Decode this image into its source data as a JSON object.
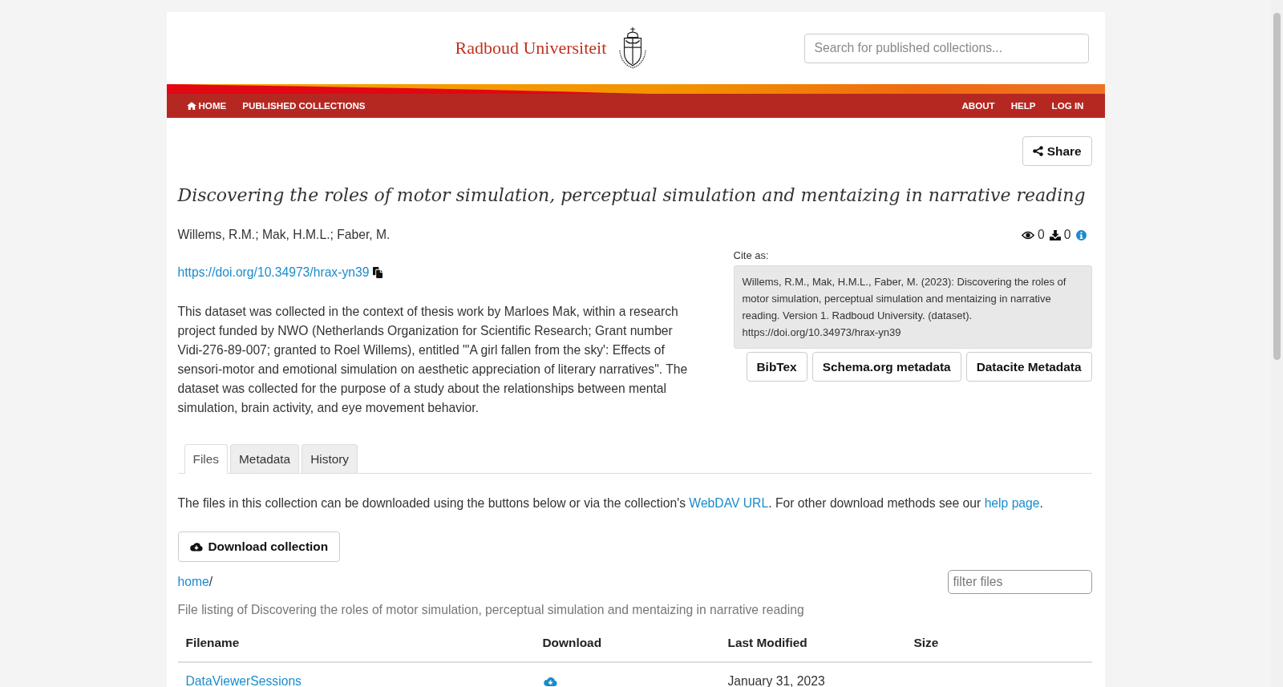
{
  "header": {
    "logo_text": "Radboud Universiteit",
    "search": {
      "placeholder": "Search for published collections..."
    }
  },
  "nav": {
    "left": [
      {
        "label": "HOME",
        "kind": "home"
      },
      {
        "label": "PUBLISHED COLLECTIONS",
        "kind": "link"
      }
    ],
    "right": [
      {
        "label": "ABOUT"
      },
      {
        "label": "HELP"
      },
      {
        "label": "LOG IN"
      }
    ]
  },
  "share_button": "Share",
  "title": "Discovering the roles of motor simulation, perceptual simulation and mentaizing in narrative reading",
  "authors": "Willems, R.M.; Mak, H.M.L.; Faber, M.",
  "doi": "https://doi.org/10.34973/hrax-yn39",
  "description": "This dataset was collected in the context of thesis work by Marloes Mak, within a research project funded by NWO (Netherlands Organization for Scientific Research; Grant number Vidi-276-89-007; granted to Roel Willems), entitled \"'A girl fallen from the sky': Effects of sensori-motor and emotional simulation on aesthetic appreciation of literary narratives\". The dataset was collected for the purpose of a study about the relationships between mental simulation, brain activity, and eye movement behavior.",
  "stats": {
    "views": "0",
    "downloads": "0"
  },
  "citation": {
    "label": "Cite as:",
    "text": "Willems, R.M., Mak, H.M.L., Faber, M. (2023): Discovering the roles of motor simulation, perceptual simulation and mentaizing in narrative reading. Version 1. Radboud University. (dataset). https://doi.org/10.34973/hrax-yn39",
    "buttons": [
      "BibTex",
      "Schema.org metadata",
      "Datacite Metadata"
    ]
  },
  "tabs": [
    {
      "label": "Files",
      "selected": true
    },
    {
      "label": "Metadata",
      "selected": false
    },
    {
      "label": "History",
      "selected": false
    }
  ],
  "files": {
    "intro": [
      {
        "kind": "text",
        "text": "The files in this collection can be downloaded using the buttons below or via the collection's "
      },
      {
        "kind": "link",
        "text": "WebDAV URL"
      },
      {
        "kind": "text",
        "text": ". For other download methods see our "
      },
      {
        "kind": "link",
        "text": "help page"
      },
      {
        "kind": "text",
        "text": "."
      }
    ],
    "download_button": "Download collection",
    "breadcrumb": {
      "link": "home",
      "separator": "/"
    },
    "filter": {
      "placeholder": "filter files"
    },
    "caption": "File listing of Discovering the roles of motor simulation, perceptual simulation and mentaizing in narrative reading",
    "table": {
      "columns": [
        "Filename",
        "Download",
        "Last Modified",
        "Size"
      ],
      "rows": [
        {
          "filename": "DataViewerSessions",
          "last_modified": "January 31, 2023"
        }
      ]
    }
  }
}
